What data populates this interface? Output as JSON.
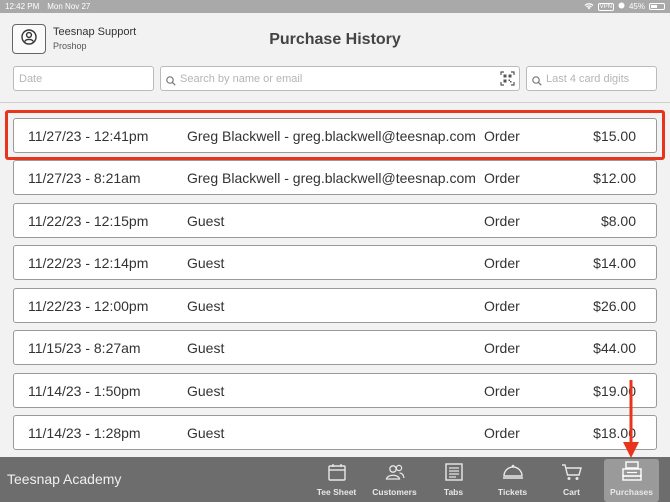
{
  "status_bar": {
    "time": "12:42 PM",
    "date": "Mon Nov 27",
    "vpn": "VPN",
    "battery": "45%"
  },
  "header": {
    "user_name": "Teesnap Support",
    "user_role": "Proshop",
    "title": "Purchase History"
  },
  "filters": {
    "date_placeholder": "Date",
    "search_placeholder": "Search by name or email",
    "card_placeholder": "Last 4 card digits"
  },
  "purchases": [
    {
      "date": "11/27/23 - 12:41pm",
      "name": "Greg  Blackwell - greg.blackwell@teesnap.com",
      "type": "Order",
      "amount": "$15.00"
    },
    {
      "date": "11/27/23 - 8:21am",
      "name": "Greg  Blackwell - greg.blackwell@teesnap.com",
      "type": "Order",
      "amount": "$12.00"
    },
    {
      "date": "11/22/23 - 12:15pm",
      "name": "Guest",
      "type": "Order",
      "amount": "$8.00"
    },
    {
      "date": "11/22/23 - 12:14pm",
      "name": "Guest",
      "type": "Order",
      "amount": "$14.00"
    },
    {
      "date": "11/22/23 - 12:00pm",
      "name": "Guest",
      "type": "Order",
      "amount": "$26.00"
    },
    {
      "date": "11/15/23 - 8:27am",
      "name": "Guest",
      "type": "Order",
      "amount": "$44.00"
    },
    {
      "date": "11/14/23 - 1:50pm",
      "name": "Guest",
      "type": "Order",
      "amount": "$19.00"
    },
    {
      "date": "11/14/23 - 1:28pm",
      "name": "Guest",
      "type": "Order",
      "amount": "$18.00"
    }
  ],
  "bottom_bar": {
    "brand": "Teesnap Academy",
    "nav": [
      {
        "label": "Tee Sheet",
        "icon": "calendar-icon"
      },
      {
        "label": "Customers",
        "icon": "customers-icon"
      },
      {
        "label": "Tabs",
        "icon": "tabs-icon"
      },
      {
        "label": "Tickets",
        "icon": "tickets-icon"
      },
      {
        "label": "Cart",
        "icon": "cart-icon"
      },
      {
        "label": "Purchases",
        "icon": "register-icon"
      }
    ]
  },
  "colors": {
    "highlight": "#e8341c",
    "bottom_bar": "#6d6d6d",
    "active_tab": "#9a9a9a"
  }
}
